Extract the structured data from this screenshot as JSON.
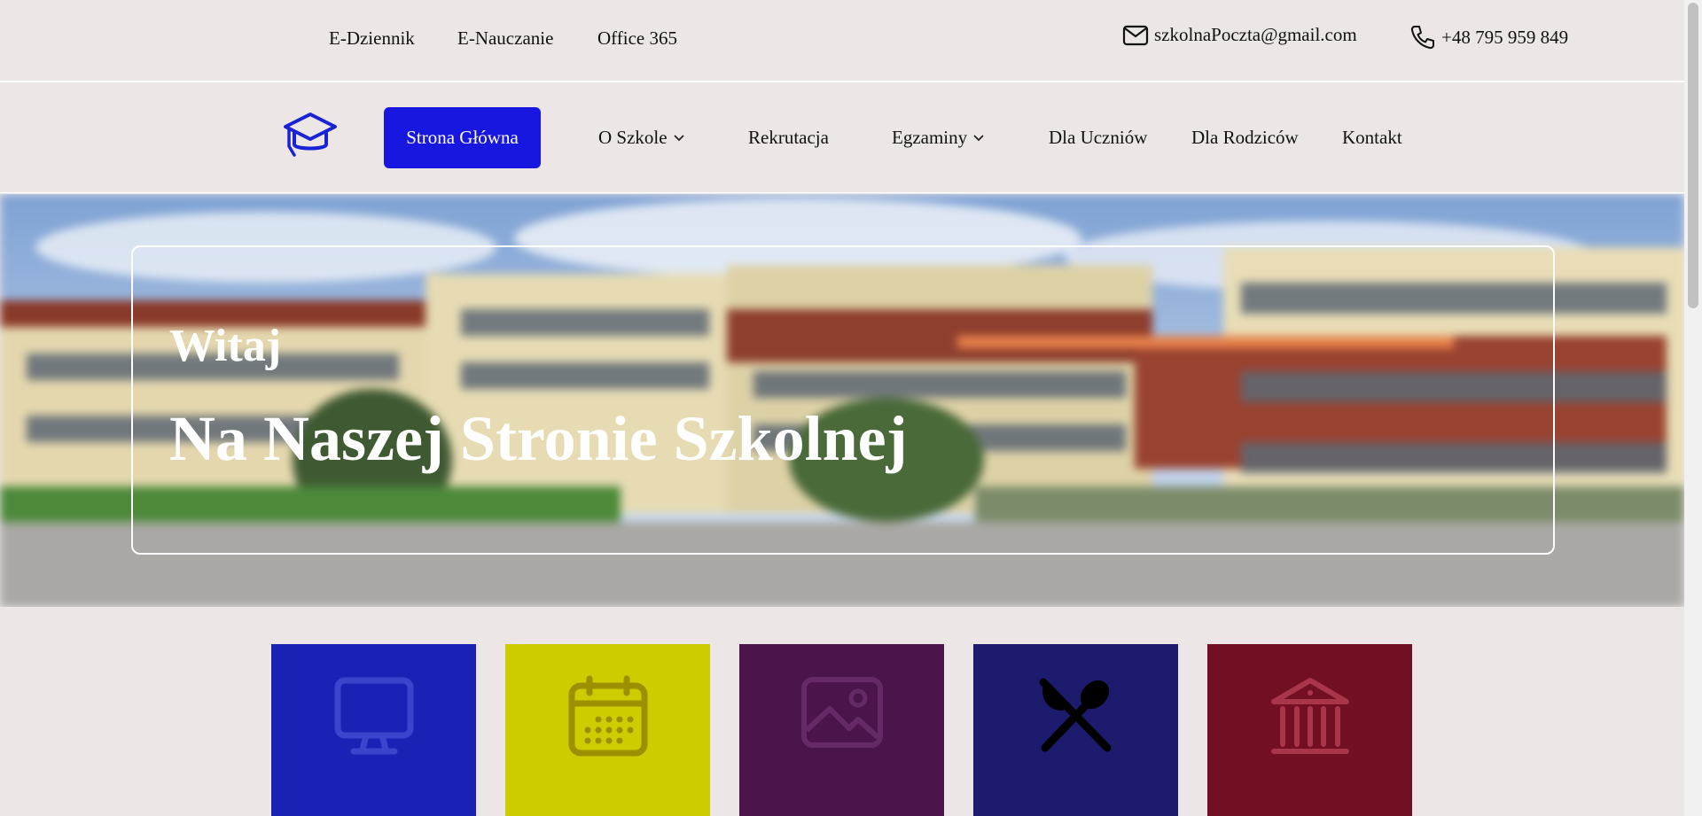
{
  "topbar": {
    "links": [
      "E-Dziennik",
      "E-Nauczanie",
      "Office 365"
    ],
    "email": "szkolnaPoczta@gmail.com",
    "phone": "+48 795 959 849"
  },
  "nav": {
    "home": "Strona Główna",
    "items": [
      "O Szkole",
      "Rekrutacja",
      "Egzaminy",
      "Dla Uczniów",
      "Dla Rodziców",
      "Kontakt"
    ],
    "accent": "#1717e0"
  },
  "hero": {
    "greeting": "Witaj",
    "title": "Na Naszej Stronie Szkolnej"
  },
  "tiles": [
    {
      "icon": "monitor-icon",
      "color": "#1a22b5"
    },
    {
      "icon": "calendar-icon",
      "color": "#cccc00"
    },
    {
      "icon": "image-icon",
      "color": "#4b144b"
    },
    {
      "icon": "fork-spoon-icon",
      "color": "#1d1b6e"
    },
    {
      "icon": "building-icon",
      "color": "#720f22"
    }
  ]
}
